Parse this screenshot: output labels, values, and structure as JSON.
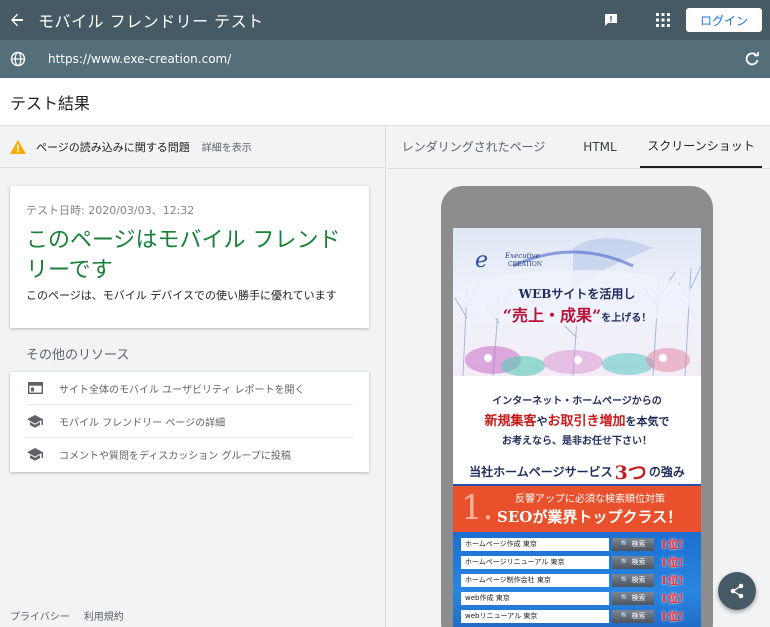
{
  "app": {
    "title": "モバイル フレンドリー テスト",
    "login_label": "ログイン"
  },
  "url_bar": {
    "url": "https://www.exe-creation.com/"
  },
  "results": {
    "title": "テスト結果"
  },
  "left": {
    "issue_text": "ページの読み込みに関する問題",
    "issue_link": "詳細を表示",
    "card": {
      "test_date": "テスト日時: 2020/03/03、12:32",
      "headline": "このページはモバイル フレンドリーです",
      "description": "このページは、モバイル デバイスでの使い勝手に優れています"
    },
    "other_resources_title": "その他のリソース",
    "resources": [
      {
        "label": "サイト全体のモバイル ユーザビリティ レポートを開く",
        "icon": "report-icon"
      },
      {
        "label": "モバイル フレンドリー ページの詳細",
        "icon": "school-icon"
      },
      {
        "label": "コメントや質問をディスカッション グループに投稿",
        "icon": "school-icon"
      }
    ],
    "footer": {
      "privacy": "プライバシー",
      "terms": "利用規約"
    }
  },
  "right": {
    "tabs": [
      {
        "label": "レンダリングされたページ",
        "active": false
      },
      {
        "label": "HTML",
        "active": false
      },
      {
        "label": "スクリーンショット",
        "active": true
      }
    ]
  },
  "site": {
    "logo_line1": "Executive",
    "logo_line2": "CREATION",
    "hero_line1": "WEBサイトを活用し",
    "hero_line2_main": "“売上・成果”",
    "hero_line2_suffix": "を上げる！",
    "sub_line1": "インターネット・ホームページからの",
    "sub_line2_red1": "新規集客",
    "sub_line2_mid": "や",
    "sub_line2_red2": "お取引き増加",
    "sub_line2_end": "を本気で",
    "sub_line3": "お考えなら、是非お任せ下さい！",
    "strength_pre": "当社ホームページサービス",
    "strength_big": "3つ",
    "strength_post": "の強み",
    "seo_number": "1.",
    "seo_line1": "反響アップに必須な検索順位対策",
    "seo_line2": "SEOが業界トップクラス！",
    "ranking": [
      {
        "keyword": "ホームページ作成 東京",
        "button": "検索",
        "result": "1位！"
      },
      {
        "keyword": "ホームページリニューアル 東京",
        "button": "検索",
        "result": "1位！"
      },
      {
        "keyword": "ホームページ制作会社 東京",
        "button": "検索",
        "result": "1位！"
      },
      {
        "keyword": "web作成 東京",
        "button": "検索",
        "result": "1位！"
      },
      {
        "keyword": "webリニューアル 東京",
        "button": "検索",
        "result": "1位！"
      }
    ]
  },
  "colors": {
    "appbar": "#455a64",
    "urlbar": "#546e7a",
    "success_green": "#188038",
    "warning": "#f9ab00",
    "site_red": "#c81c1c",
    "site_orange": "#e8512b"
  }
}
